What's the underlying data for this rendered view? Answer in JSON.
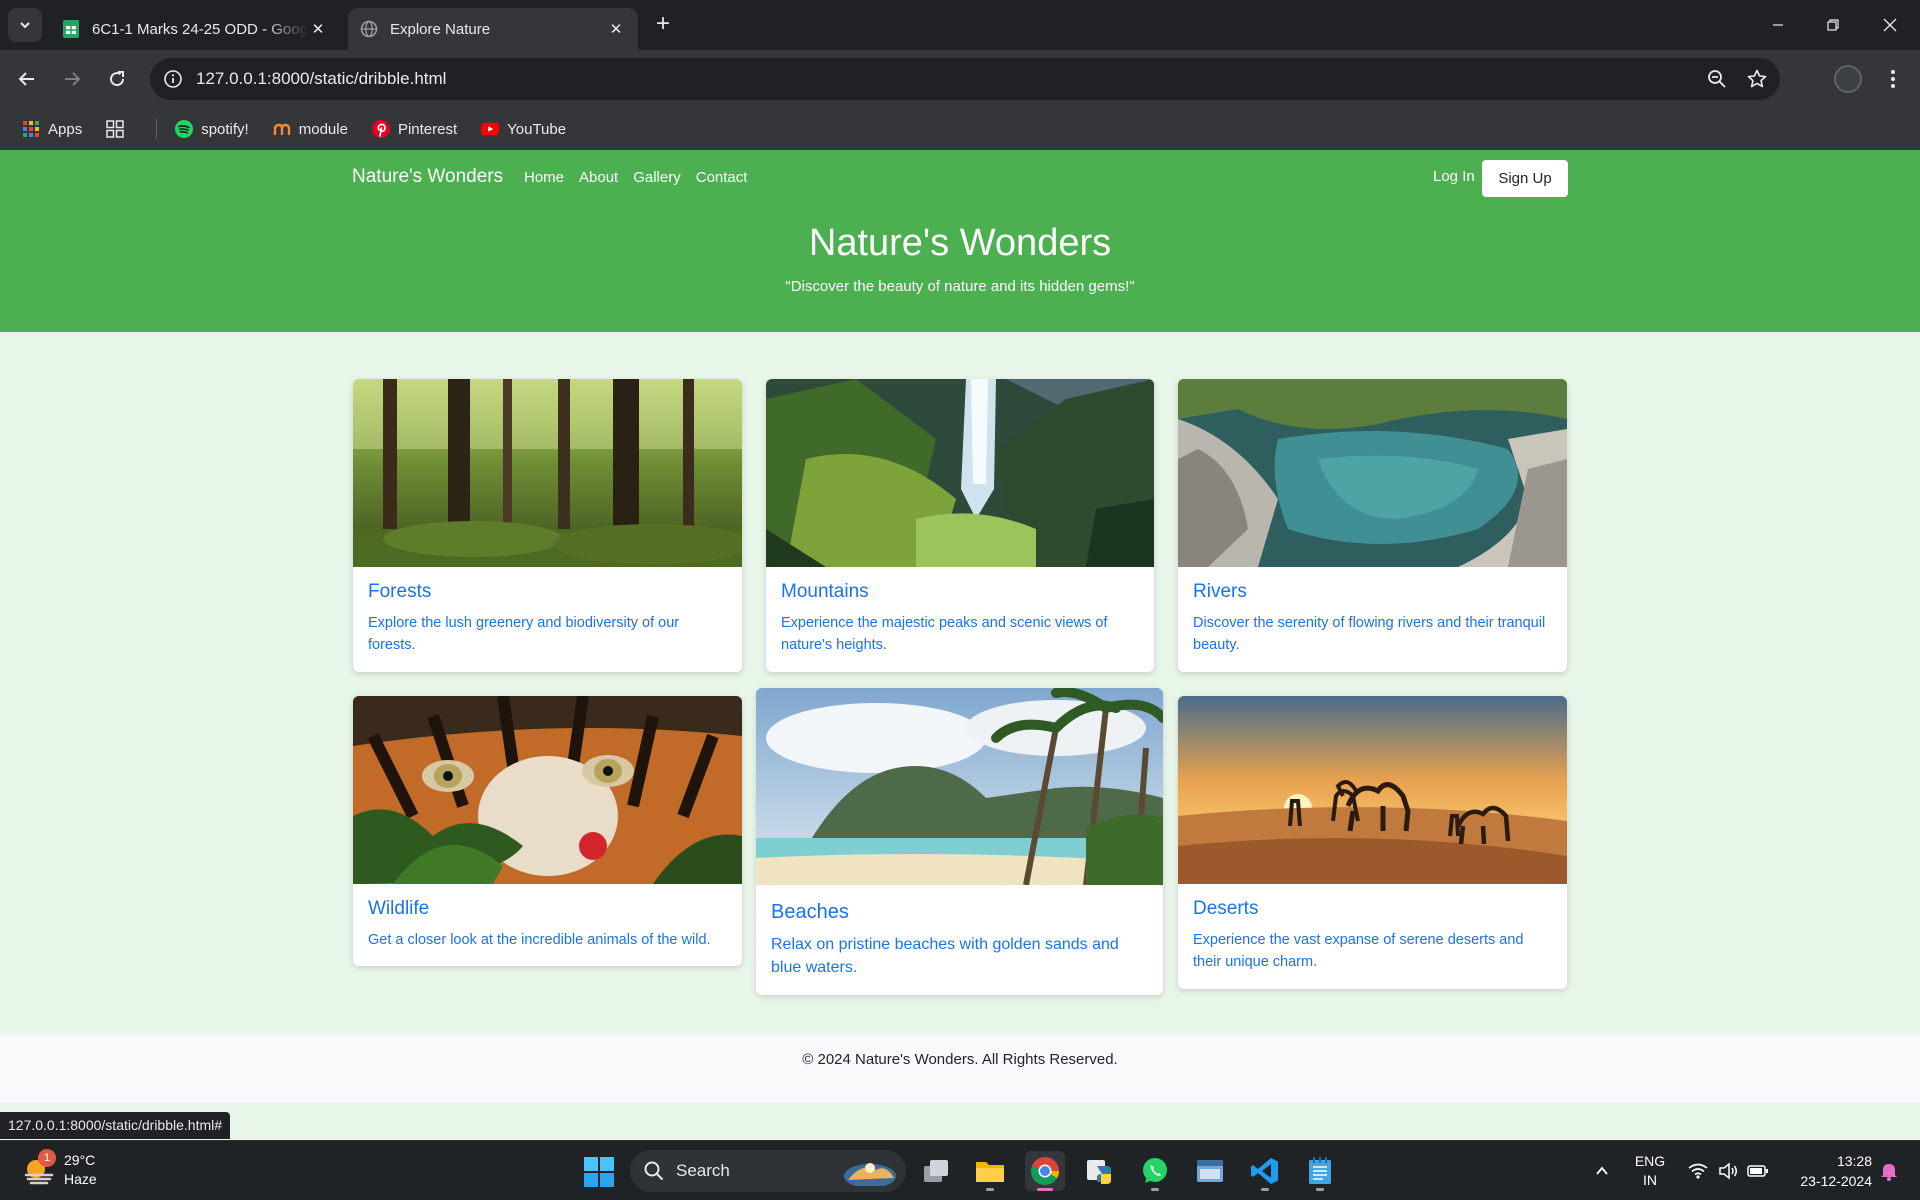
{
  "browser": {
    "tabs": [
      {
        "title": "6C1-1 Marks 24-25 ODD - Google Sheets",
        "active": false
      },
      {
        "title": "Explore Nature",
        "active": true
      }
    ],
    "url": "127.0.0.1:8000/static/dribble.html",
    "bookmarks": [
      "Apps",
      "spotify!",
      "module",
      "Pinterest",
      "YouTube"
    ],
    "status_url": "127.0.0.1:8000/static/dribble.html#"
  },
  "page": {
    "brand": "Nature's Wonders",
    "nav": [
      "Home",
      "About",
      "Gallery",
      "Contact"
    ],
    "login": "Log In",
    "signup": "Sign Up",
    "hero_title": "Nature's Wonders",
    "hero_subtitle": "\"Discover the beauty of nature and its hidden gems!\"",
    "cards": [
      {
        "title": "Forests",
        "text": "Explore the lush greenery and biodiversity of our forests."
      },
      {
        "title": "Mountains",
        "text": "Experience the majestic peaks and scenic views of nature's heights."
      },
      {
        "title": "Rivers",
        "text": "Discover the serenity of flowing rivers and their tranquil beauty."
      },
      {
        "title": "Wildlife",
        "text": "Get a closer look at the incredible animals of the wild."
      },
      {
        "title": "Beaches",
        "text": "Relax on pristine beaches with golden sands and blue waters."
      },
      {
        "title": "Deserts",
        "text": "Experience the vast expanse of serene deserts and their unique charm."
      }
    ],
    "footer": "© 2024 Nature's Wonders. All Rights Reserved.",
    "colors": {
      "primary": "#4caf50",
      "page_bg": "#e8f5e9",
      "link": "#1a73e8"
    }
  },
  "taskbar": {
    "weather": {
      "temp": "29°C",
      "condition": "Haze",
      "badge": "1"
    },
    "search_placeholder": "Search",
    "language": [
      "ENG",
      "IN"
    ],
    "time": "13:28",
    "date": "23-12-2024"
  }
}
